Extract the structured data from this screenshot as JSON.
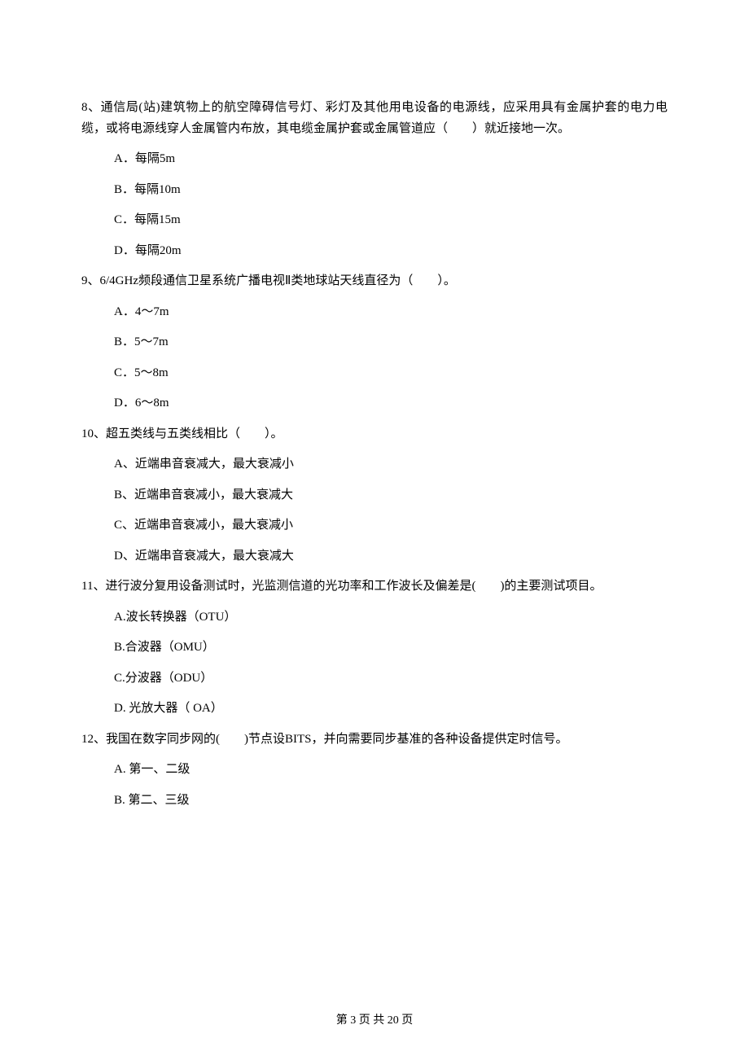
{
  "questions": [
    {
      "stem": "8、通信局(站)建筑物上的航空障碍信号灯、彩灯及其他用电设备的电源线，应采用具有金属护套的电力电缆，或将电源线穿人金属管内布放，其电缆金属护套或金属管道应（　　）就近接地一次。",
      "options": [
        "A．每隔5m",
        "B．每隔10m",
        "C．每隔15m",
        "D．每隔20m"
      ]
    },
    {
      "stem": "9、6/4GHz频段通信卫星系统广播电视Ⅱ类地球站天线直径为（　　）。",
      "options": [
        "A．4～7m",
        "B．5～7m",
        "C．5～8m",
        "D．6～8m"
      ]
    },
    {
      "stem": "10、超五类线与五类线相比（　　）。",
      "options": [
        "A、近端串音衰减大，最大衰减小",
        "B、近端串音衰减小，最大衰减大",
        "C、近端串音衰减小，最大衰减小",
        "D、近端串音衰减大，最大衰减大"
      ]
    },
    {
      "stem": "11、进行波分复用设备测试时，光监测信道的光功率和工作波长及偏差是(　　)的主要测试项目。",
      "options": [
        "A.波长转换器（OTU）",
        "B.合波器（OMU）",
        "C.分波器（ODU）",
        "D. 光放大器（ OA）"
      ]
    },
    {
      "stem": "12、我国在数字同步网的(　　)节点设BITS，并向需要同步基准的各种设备提供定时信号。",
      "options": [
        "A. 第一、二级",
        "B. 第二、三级"
      ]
    }
  ],
  "footer": "第 3 页 共 20 页"
}
